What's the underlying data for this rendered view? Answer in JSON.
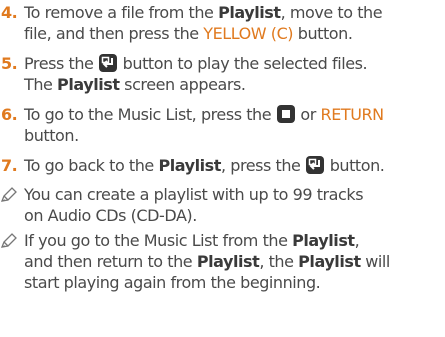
{
  "steps": [
    {
      "number": "4.",
      "line1": [
        "To remove a file from the ",
        "Playlist",
        ", move to the"
      ],
      "line2": [
        "file, and then press the ",
        "YELLOW (C)",
        " button."
      ]
    },
    {
      "number": "5.",
      "line1": [
        "Press the ",
        " button to play the selected files."
      ],
      "line2": [
        "The ",
        "Playlist",
        " screen appears."
      ]
    },
    {
      "number": "6.",
      "line1": [
        "To go to the Music List, press the ",
        " or ",
        "RETURN"
      ],
      "line2": [
        "button."
      ]
    },
    {
      "number": "7.",
      "line1": [
        "To go back to the ",
        "Playlist",
        ", press the ",
        " button."
      ]
    }
  ],
  "notes": [
    {
      "lines": [
        [
          "You can create a playlist with up to 99 tracks"
        ],
        [
          "on Audio CDs (CD-DA)."
        ]
      ]
    },
    {
      "lines": [
        [
          "If you go to the Music List from the ",
          "Playlist",
          ","
        ],
        [
          "and then return to the ",
          "Playlist",
          ", the ",
          "Playlist",
          " will"
        ],
        [
          "start playing again from the beginning."
        ]
      ]
    }
  ],
  "icons": {
    "enter": "enter-button-icon",
    "stop": "stop-button-icon",
    "note": "note-pencil-icon"
  },
  "colors": {
    "text": "#4a4a4a",
    "bold": "#3a3a3a",
    "accent": "#e07a1f",
    "button": "#333333"
  }
}
